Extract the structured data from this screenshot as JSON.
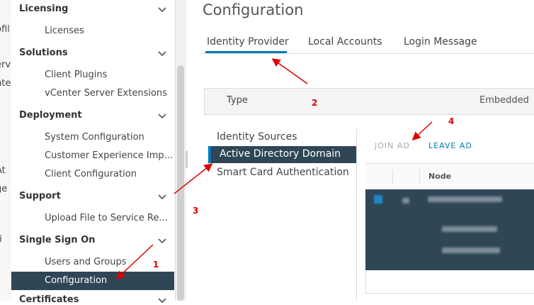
{
  "edge": [
    "ofil",
    "erv",
    "nter",
    "At",
    "ge",
    "ti"
  ],
  "sidebar": {
    "sections": [
      {
        "label": "Licensing",
        "items": [
          "Licenses"
        ]
      },
      {
        "label": "Solutions",
        "items": [
          "Client Plugins",
          "vCenter Server Extensions"
        ]
      },
      {
        "label": "Deployment",
        "items": [
          "System Configuration",
          "Customer Experience Imp...",
          "Client Configuration"
        ]
      },
      {
        "label": "Support",
        "items": [
          "Upload File to Service Re..."
        ]
      },
      {
        "label": "Single Sign On",
        "items": [
          "Users and Groups",
          "Configuration"
        ]
      }
    ],
    "partial_next": "Certificates"
  },
  "main": {
    "title": "Configuration",
    "tabs": [
      "Identity Provider",
      "Local Accounts",
      "Login Message"
    ],
    "active_tab": "Identity Provider",
    "type_label": "Type",
    "type_value": "Embedded",
    "vnav": [
      "Identity Sources",
      "Active Directory Domain",
      "Smart Card Authentication"
    ],
    "active_vnav": "Active Directory Domain",
    "actions": {
      "join": "JOIN AD",
      "leave": "LEAVE AD"
    },
    "grid": {
      "column": "Node"
    }
  },
  "annotations": [
    "1",
    "2",
    "3",
    "4"
  ],
  "colors": {
    "accent": "#0079b8",
    "active_bg": "#2f4656",
    "annotation": "#dd0000"
  }
}
